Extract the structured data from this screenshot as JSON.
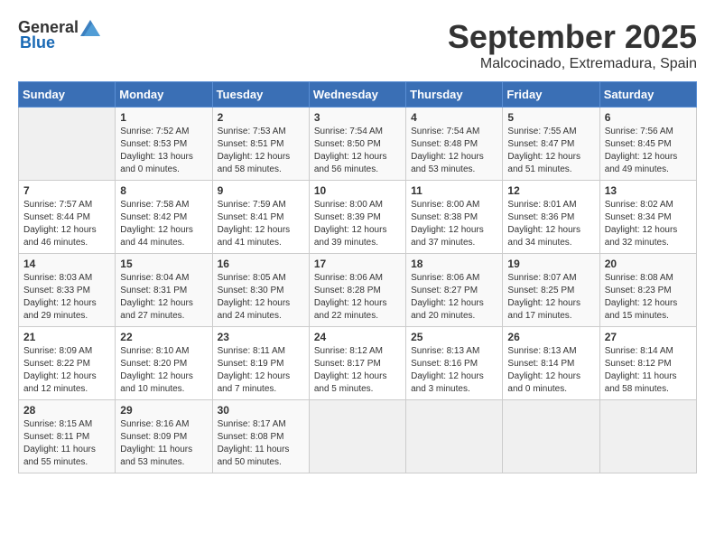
{
  "logo": {
    "general": "General",
    "blue": "Blue"
  },
  "title": "September 2025",
  "location": "Malcocinado, Extremadura, Spain",
  "days_header": [
    "Sunday",
    "Monday",
    "Tuesday",
    "Wednesday",
    "Thursday",
    "Friday",
    "Saturday"
  ],
  "weeks": [
    [
      {
        "day": "",
        "sunrise": "",
        "sunset": "",
        "daylight": ""
      },
      {
        "day": "1",
        "sunrise": "Sunrise: 7:52 AM",
        "sunset": "Sunset: 8:53 PM",
        "daylight": "Daylight: 13 hours and 0 minutes."
      },
      {
        "day": "2",
        "sunrise": "Sunrise: 7:53 AM",
        "sunset": "Sunset: 8:51 PM",
        "daylight": "Daylight: 12 hours and 58 minutes."
      },
      {
        "day": "3",
        "sunrise": "Sunrise: 7:54 AM",
        "sunset": "Sunset: 8:50 PM",
        "daylight": "Daylight: 12 hours and 56 minutes."
      },
      {
        "day": "4",
        "sunrise": "Sunrise: 7:54 AM",
        "sunset": "Sunset: 8:48 PM",
        "daylight": "Daylight: 12 hours and 53 minutes."
      },
      {
        "day": "5",
        "sunrise": "Sunrise: 7:55 AM",
        "sunset": "Sunset: 8:47 PM",
        "daylight": "Daylight: 12 hours and 51 minutes."
      },
      {
        "day": "6",
        "sunrise": "Sunrise: 7:56 AM",
        "sunset": "Sunset: 8:45 PM",
        "daylight": "Daylight: 12 hours and 49 minutes."
      }
    ],
    [
      {
        "day": "7",
        "sunrise": "Sunrise: 7:57 AM",
        "sunset": "Sunset: 8:44 PM",
        "daylight": "Daylight: 12 hours and 46 minutes."
      },
      {
        "day": "8",
        "sunrise": "Sunrise: 7:58 AM",
        "sunset": "Sunset: 8:42 PM",
        "daylight": "Daylight: 12 hours and 44 minutes."
      },
      {
        "day": "9",
        "sunrise": "Sunrise: 7:59 AM",
        "sunset": "Sunset: 8:41 PM",
        "daylight": "Daylight: 12 hours and 41 minutes."
      },
      {
        "day": "10",
        "sunrise": "Sunrise: 8:00 AM",
        "sunset": "Sunset: 8:39 PM",
        "daylight": "Daylight: 12 hours and 39 minutes."
      },
      {
        "day": "11",
        "sunrise": "Sunrise: 8:00 AM",
        "sunset": "Sunset: 8:38 PM",
        "daylight": "Daylight: 12 hours and 37 minutes."
      },
      {
        "day": "12",
        "sunrise": "Sunrise: 8:01 AM",
        "sunset": "Sunset: 8:36 PM",
        "daylight": "Daylight: 12 hours and 34 minutes."
      },
      {
        "day": "13",
        "sunrise": "Sunrise: 8:02 AM",
        "sunset": "Sunset: 8:34 PM",
        "daylight": "Daylight: 12 hours and 32 minutes."
      }
    ],
    [
      {
        "day": "14",
        "sunrise": "Sunrise: 8:03 AM",
        "sunset": "Sunset: 8:33 PM",
        "daylight": "Daylight: 12 hours and 29 minutes."
      },
      {
        "day": "15",
        "sunrise": "Sunrise: 8:04 AM",
        "sunset": "Sunset: 8:31 PM",
        "daylight": "Daylight: 12 hours and 27 minutes."
      },
      {
        "day": "16",
        "sunrise": "Sunrise: 8:05 AM",
        "sunset": "Sunset: 8:30 PM",
        "daylight": "Daylight: 12 hours and 24 minutes."
      },
      {
        "day": "17",
        "sunrise": "Sunrise: 8:06 AM",
        "sunset": "Sunset: 8:28 PM",
        "daylight": "Daylight: 12 hours and 22 minutes."
      },
      {
        "day": "18",
        "sunrise": "Sunrise: 8:06 AM",
        "sunset": "Sunset: 8:27 PM",
        "daylight": "Daylight: 12 hours and 20 minutes."
      },
      {
        "day": "19",
        "sunrise": "Sunrise: 8:07 AM",
        "sunset": "Sunset: 8:25 PM",
        "daylight": "Daylight: 12 hours and 17 minutes."
      },
      {
        "day": "20",
        "sunrise": "Sunrise: 8:08 AM",
        "sunset": "Sunset: 8:23 PM",
        "daylight": "Daylight: 12 hours and 15 minutes."
      }
    ],
    [
      {
        "day": "21",
        "sunrise": "Sunrise: 8:09 AM",
        "sunset": "Sunset: 8:22 PM",
        "daylight": "Daylight: 12 hours and 12 minutes."
      },
      {
        "day": "22",
        "sunrise": "Sunrise: 8:10 AM",
        "sunset": "Sunset: 8:20 PM",
        "daylight": "Daylight: 12 hours and 10 minutes."
      },
      {
        "day": "23",
        "sunrise": "Sunrise: 8:11 AM",
        "sunset": "Sunset: 8:19 PM",
        "daylight": "Daylight: 12 hours and 7 minutes."
      },
      {
        "day": "24",
        "sunrise": "Sunrise: 8:12 AM",
        "sunset": "Sunset: 8:17 PM",
        "daylight": "Daylight: 12 hours and 5 minutes."
      },
      {
        "day": "25",
        "sunrise": "Sunrise: 8:13 AM",
        "sunset": "Sunset: 8:16 PM",
        "daylight": "Daylight: 12 hours and 3 minutes."
      },
      {
        "day": "26",
        "sunrise": "Sunrise: 8:13 AM",
        "sunset": "Sunset: 8:14 PM",
        "daylight": "Daylight: 12 hours and 0 minutes."
      },
      {
        "day": "27",
        "sunrise": "Sunrise: 8:14 AM",
        "sunset": "Sunset: 8:12 PM",
        "daylight": "Daylight: 11 hours and 58 minutes."
      }
    ],
    [
      {
        "day": "28",
        "sunrise": "Sunrise: 8:15 AM",
        "sunset": "Sunset: 8:11 PM",
        "daylight": "Daylight: 11 hours and 55 minutes."
      },
      {
        "day": "29",
        "sunrise": "Sunrise: 8:16 AM",
        "sunset": "Sunset: 8:09 PM",
        "daylight": "Daylight: 11 hours and 53 minutes."
      },
      {
        "day": "30",
        "sunrise": "Sunrise: 8:17 AM",
        "sunset": "Sunset: 8:08 PM",
        "daylight": "Daylight: 11 hours and 50 minutes."
      },
      {
        "day": "",
        "sunrise": "",
        "sunset": "",
        "daylight": ""
      },
      {
        "day": "",
        "sunrise": "",
        "sunset": "",
        "daylight": ""
      },
      {
        "day": "",
        "sunrise": "",
        "sunset": "",
        "daylight": ""
      },
      {
        "day": "",
        "sunrise": "",
        "sunset": "",
        "daylight": ""
      }
    ]
  ]
}
